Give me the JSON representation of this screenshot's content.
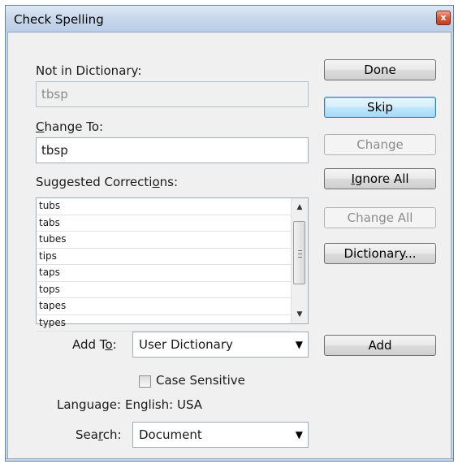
{
  "window": {
    "title": "Check Spelling",
    "close_glyph": "x"
  },
  "not_in_dictionary": {
    "label": "Not in Dictionary:",
    "value": "tbsp"
  },
  "change_to": {
    "label_prefix": "C",
    "label_rest": "hange To:",
    "value": "tbsp"
  },
  "suggested": {
    "label_prefix": "Suggested Correcti",
    "label_mnemonic": "o",
    "label_suffix": "ns:",
    "items": [
      "tubs",
      "tabs",
      "tubes",
      "tips",
      "taps",
      "tops",
      "tapes",
      "types"
    ]
  },
  "buttons": {
    "done": "Done",
    "skip": "Skip",
    "change": "Change",
    "ignore_all_mnemonic": "I",
    "ignore_all_rest": "gnore All",
    "change_all": "Change All",
    "dictionary": "Dictionary...",
    "add": "Add"
  },
  "add_to": {
    "label_prefix": "Add T",
    "label_mnemonic": "o",
    "label_suffix": ":",
    "value": "User Dictionary"
  },
  "case_sensitive": {
    "label": "Case Sensitive",
    "checked": false
  },
  "language": {
    "label": "Language:",
    "value": "English: USA"
  },
  "search": {
    "label_prefix": "Sea",
    "label_mnemonic": "r",
    "label_suffix": "ch:",
    "value": "Document"
  },
  "icons": {
    "dropdown": "chevron-down-icon",
    "scroll_up": "scroll-up-arrow-icon",
    "scroll_down": "scroll-down-arrow-icon"
  }
}
